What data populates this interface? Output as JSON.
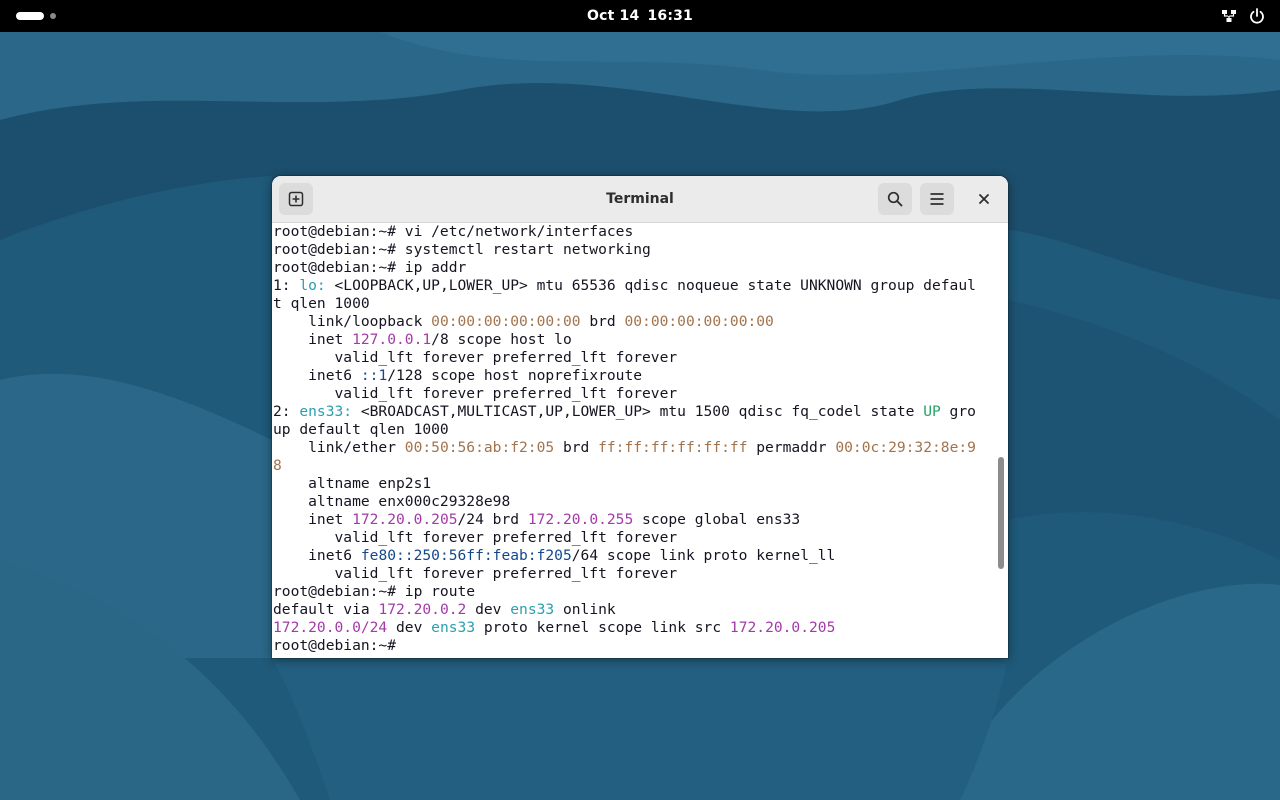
{
  "topbar": {
    "date": "Oct 14",
    "time": "16:31",
    "icons": [
      "activities-indicator",
      "network-question-icon",
      "power-icon"
    ]
  },
  "window": {
    "title": "Terminal",
    "icons": [
      "new-tab-icon",
      "search-icon",
      "hamburger-menu-icon",
      "close-icon"
    ]
  },
  "terminal": {
    "lines": [
      [
        {
          "t": "root@debian:~# vi /etc/network/interfaces",
          "c": ""
        }
      ],
      [
        {
          "t": "root@debian:~# systemctl restart networking",
          "c": ""
        }
      ],
      [
        {
          "t": "root@debian:~# ip addr",
          "c": ""
        }
      ],
      [
        {
          "t": "1: ",
          "c": ""
        },
        {
          "t": "lo:",
          "c": "cyan"
        },
        {
          "t": " <LOOPBACK,UP,LOWER_UP> mtu 65536 qdisc noqueue state UNKNOWN group defaul",
          "c": ""
        }
      ],
      [
        {
          "t": "t qlen 1000",
          "c": ""
        }
      ],
      [
        {
          "t": "    link/loopback ",
          "c": ""
        },
        {
          "t": "00:00:00:00:00:00",
          "c": "brown"
        },
        {
          "t": " brd ",
          "c": ""
        },
        {
          "t": "00:00:00:00:00:00",
          "c": "brown"
        }
      ],
      [
        {
          "t": "    inet ",
          "c": ""
        },
        {
          "t": "127.0.0.1",
          "c": "mag"
        },
        {
          "t": "/8 scope host lo",
          "c": ""
        }
      ],
      [
        {
          "t": "       valid_lft forever preferred_lft forever",
          "c": ""
        }
      ],
      [
        {
          "t": "    inet6 ",
          "c": ""
        },
        {
          "t": "::1",
          "c": "blue"
        },
        {
          "t": "/128 scope host noprefixroute",
          "c": ""
        }
      ],
      [
        {
          "t": "       valid_lft forever preferred_lft forever",
          "c": ""
        }
      ],
      [
        {
          "t": "2: ",
          "c": ""
        },
        {
          "t": "ens33:",
          "c": "cyan"
        },
        {
          "t": " <BROADCAST,MULTICAST,UP,LOWER_UP> mtu 1500 qdisc fq_codel state ",
          "c": ""
        },
        {
          "t": "UP",
          "c": "green"
        },
        {
          "t": " gro",
          "c": ""
        }
      ],
      [
        {
          "t": "up default qlen 1000",
          "c": ""
        }
      ],
      [
        {
          "t": "    link/ether ",
          "c": ""
        },
        {
          "t": "00:50:56:ab:f2:05",
          "c": "brown"
        },
        {
          "t": " brd ",
          "c": ""
        },
        {
          "t": "ff:ff:ff:ff:ff:ff",
          "c": "brown"
        },
        {
          "t": " permaddr ",
          "c": ""
        },
        {
          "t": "00:0c:29:32:8e:9",
          "c": "brown"
        }
      ],
      [
        {
          "t": "8",
          "c": "brown"
        }
      ],
      [
        {
          "t": "    altname enp2s1",
          "c": ""
        }
      ],
      [
        {
          "t": "    altname enx000c29328e98",
          "c": ""
        }
      ],
      [
        {
          "t": "    inet ",
          "c": ""
        },
        {
          "t": "172.20.0.205",
          "c": "mag"
        },
        {
          "t": "/24 brd ",
          "c": ""
        },
        {
          "t": "172.20.0.255",
          "c": "mag"
        },
        {
          "t": " scope global ens33",
          "c": ""
        }
      ],
      [
        {
          "t": "       valid_lft forever preferred_lft forever",
          "c": ""
        }
      ],
      [
        {
          "t": "    inet6 ",
          "c": ""
        },
        {
          "t": "fe80::250:56ff:feab:f205",
          "c": "blue"
        },
        {
          "t": "/64 scope link proto kernel_ll",
          "c": ""
        }
      ],
      [
        {
          "t": "       valid_lft forever preferred_lft forever",
          "c": ""
        }
      ],
      [
        {
          "t": "root@debian:~# ip route",
          "c": ""
        }
      ],
      [
        {
          "t": "default via ",
          "c": ""
        },
        {
          "t": "172.20.0.2",
          "c": "mag"
        },
        {
          "t": " dev ",
          "c": ""
        },
        {
          "t": "ens33",
          "c": "cyan"
        },
        {
          "t": " onlink",
          "c": ""
        }
      ],
      [
        {
          "t": "172.20.0.0/24",
          "c": "mag"
        },
        {
          "t": " dev ",
          "c": ""
        },
        {
          "t": "ens33",
          "c": "cyan"
        },
        {
          "t": " proto kernel scope link src ",
          "c": ""
        },
        {
          "t": "172.20.0.205",
          "c": "mag"
        }
      ],
      [
        {
          "t": "root@debian:~# ",
          "c": ""
        }
      ]
    ],
    "scroll_position": 0.73
  },
  "colors": {
    "desktop_bg": "#1f5a7a",
    "accent_cyan": "#2a9fb0",
    "accent_magenta": "#a23aa8",
    "accent_brown": "#a2734c",
    "accent_green": "#26a269",
    "accent_blue": "#12488b"
  }
}
